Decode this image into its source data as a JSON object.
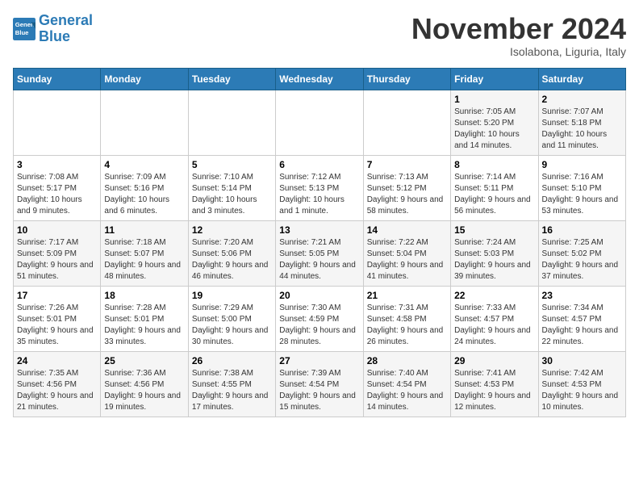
{
  "logo": {
    "line1": "General",
    "line2": "Blue"
  },
  "title": "November 2024",
  "subtitle": "Isolabona, Liguria, Italy",
  "days_of_week": [
    "Sunday",
    "Monday",
    "Tuesday",
    "Wednesday",
    "Thursday",
    "Friday",
    "Saturday"
  ],
  "weeks": [
    [
      {
        "day": "",
        "info": ""
      },
      {
        "day": "",
        "info": ""
      },
      {
        "day": "",
        "info": ""
      },
      {
        "day": "",
        "info": ""
      },
      {
        "day": "",
        "info": ""
      },
      {
        "day": "1",
        "info": "Sunrise: 7:05 AM\nSunset: 5:20 PM\nDaylight: 10 hours and 14 minutes."
      },
      {
        "day": "2",
        "info": "Sunrise: 7:07 AM\nSunset: 5:18 PM\nDaylight: 10 hours and 11 minutes."
      }
    ],
    [
      {
        "day": "3",
        "info": "Sunrise: 7:08 AM\nSunset: 5:17 PM\nDaylight: 10 hours and 9 minutes."
      },
      {
        "day": "4",
        "info": "Sunrise: 7:09 AM\nSunset: 5:16 PM\nDaylight: 10 hours and 6 minutes."
      },
      {
        "day": "5",
        "info": "Sunrise: 7:10 AM\nSunset: 5:14 PM\nDaylight: 10 hours and 3 minutes."
      },
      {
        "day": "6",
        "info": "Sunrise: 7:12 AM\nSunset: 5:13 PM\nDaylight: 10 hours and 1 minute."
      },
      {
        "day": "7",
        "info": "Sunrise: 7:13 AM\nSunset: 5:12 PM\nDaylight: 9 hours and 58 minutes."
      },
      {
        "day": "8",
        "info": "Sunrise: 7:14 AM\nSunset: 5:11 PM\nDaylight: 9 hours and 56 minutes."
      },
      {
        "day": "9",
        "info": "Sunrise: 7:16 AM\nSunset: 5:10 PM\nDaylight: 9 hours and 53 minutes."
      }
    ],
    [
      {
        "day": "10",
        "info": "Sunrise: 7:17 AM\nSunset: 5:09 PM\nDaylight: 9 hours and 51 minutes."
      },
      {
        "day": "11",
        "info": "Sunrise: 7:18 AM\nSunset: 5:07 PM\nDaylight: 9 hours and 48 minutes."
      },
      {
        "day": "12",
        "info": "Sunrise: 7:20 AM\nSunset: 5:06 PM\nDaylight: 9 hours and 46 minutes."
      },
      {
        "day": "13",
        "info": "Sunrise: 7:21 AM\nSunset: 5:05 PM\nDaylight: 9 hours and 44 minutes."
      },
      {
        "day": "14",
        "info": "Sunrise: 7:22 AM\nSunset: 5:04 PM\nDaylight: 9 hours and 41 minutes."
      },
      {
        "day": "15",
        "info": "Sunrise: 7:24 AM\nSunset: 5:03 PM\nDaylight: 9 hours and 39 minutes."
      },
      {
        "day": "16",
        "info": "Sunrise: 7:25 AM\nSunset: 5:02 PM\nDaylight: 9 hours and 37 minutes."
      }
    ],
    [
      {
        "day": "17",
        "info": "Sunrise: 7:26 AM\nSunset: 5:01 PM\nDaylight: 9 hours and 35 minutes."
      },
      {
        "day": "18",
        "info": "Sunrise: 7:28 AM\nSunset: 5:01 PM\nDaylight: 9 hours and 33 minutes."
      },
      {
        "day": "19",
        "info": "Sunrise: 7:29 AM\nSunset: 5:00 PM\nDaylight: 9 hours and 30 minutes."
      },
      {
        "day": "20",
        "info": "Sunrise: 7:30 AM\nSunset: 4:59 PM\nDaylight: 9 hours and 28 minutes."
      },
      {
        "day": "21",
        "info": "Sunrise: 7:31 AM\nSunset: 4:58 PM\nDaylight: 9 hours and 26 minutes."
      },
      {
        "day": "22",
        "info": "Sunrise: 7:33 AM\nSunset: 4:57 PM\nDaylight: 9 hours and 24 minutes."
      },
      {
        "day": "23",
        "info": "Sunrise: 7:34 AM\nSunset: 4:57 PM\nDaylight: 9 hours and 22 minutes."
      }
    ],
    [
      {
        "day": "24",
        "info": "Sunrise: 7:35 AM\nSunset: 4:56 PM\nDaylight: 9 hours and 21 minutes."
      },
      {
        "day": "25",
        "info": "Sunrise: 7:36 AM\nSunset: 4:56 PM\nDaylight: 9 hours and 19 minutes."
      },
      {
        "day": "26",
        "info": "Sunrise: 7:38 AM\nSunset: 4:55 PM\nDaylight: 9 hours and 17 minutes."
      },
      {
        "day": "27",
        "info": "Sunrise: 7:39 AM\nSunset: 4:54 PM\nDaylight: 9 hours and 15 minutes."
      },
      {
        "day": "28",
        "info": "Sunrise: 7:40 AM\nSunset: 4:54 PM\nDaylight: 9 hours and 14 minutes."
      },
      {
        "day": "29",
        "info": "Sunrise: 7:41 AM\nSunset: 4:53 PM\nDaylight: 9 hours and 12 minutes."
      },
      {
        "day": "30",
        "info": "Sunrise: 7:42 AM\nSunset: 4:53 PM\nDaylight: 9 hours and 10 minutes."
      }
    ]
  ]
}
